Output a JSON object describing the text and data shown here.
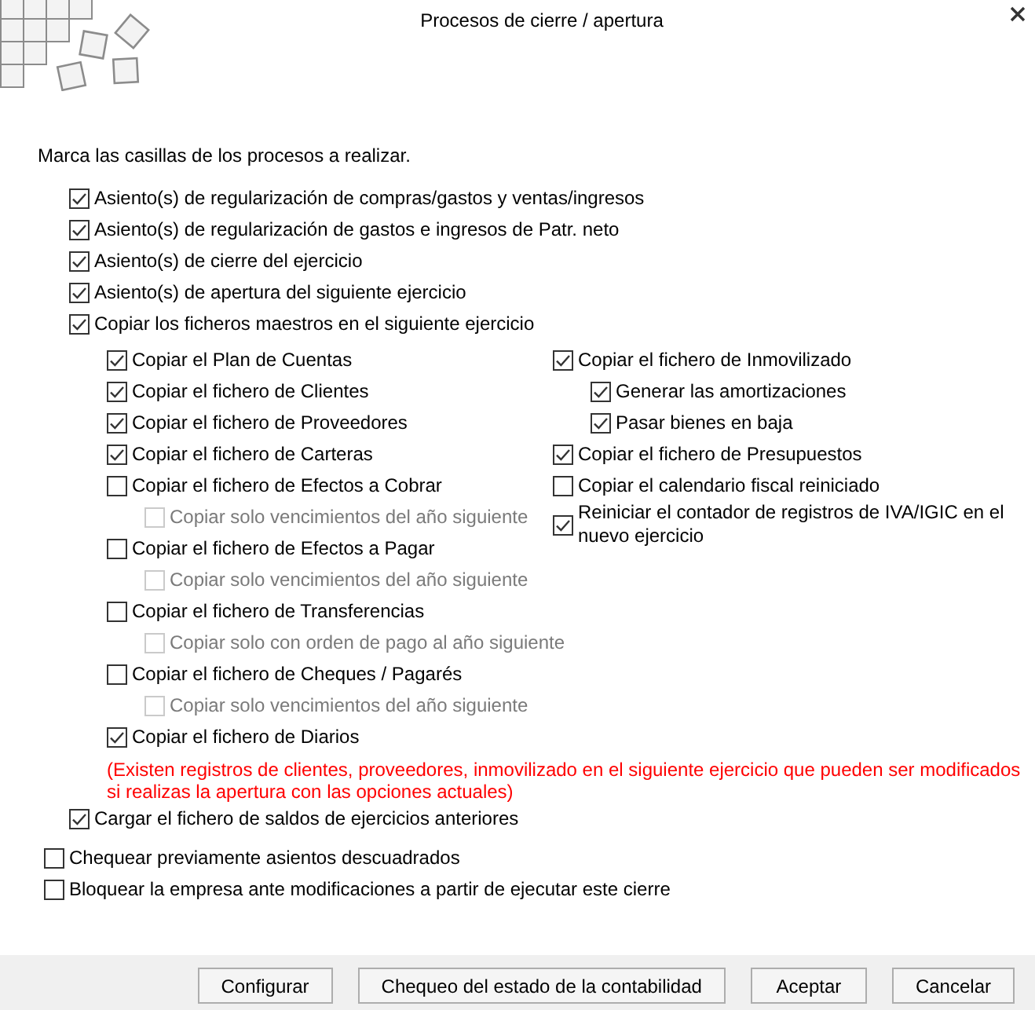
{
  "window": {
    "title": "Procesos de cierre / apertura"
  },
  "instruction": "Marca las casillas de los procesos a realizar.",
  "processes": [
    {
      "label": "Asiento(s) de regularización de compras/gastos y ventas/ingresos",
      "checked": true
    },
    {
      "label": "Asiento(s) de regularización de gastos e ingresos de Patr. neto",
      "checked": true
    },
    {
      "label": "Asiento(s) de cierre del ejercicio",
      "checked": true
    },
    {
      "label": "Asiento(s) de apertura del siguiente ejercicio",
      "checked": true
    },
    {
      "label": "Copiar los ficheros maestros en el siguiente ejercicio",
      "checked": true,
      "columns": [
        {
          "items": [
            {
              "label": "Copiar el Plan de Cuentas",
              "checked": true
            },
            {
              "label": "Copiar el fichero de Clientes",
              "checked": true
            },
            {
              "label": "Copiar el fichero de Proveedores",
              "checked": true
            },
            {
              "label": "Copiar el fichero de Carteras",
              "checked": true
            },
            {
              "label": "Copiar el fichero de Efectos a Cobrar",
              "checked": false,
              "children": [
                {
                  "label": "Copiar solo vencimientos del año siguiente",
                  "checked": false,
                  "disabled": true
                }
              ]
            },
            {
              "label": "Copiar el fichero de Efectos a Pagar",
              "checked": false,
              "children": [
                {
                  "label": "Copiar solo vencimientos del año siguiente",
                  "checked": false,
                  "disabled": true
                }
              ]
            },
            {
              "label": "Copiar el fichero de Transferencias",
              "checked": false,
              "children": [
                {
                  "label": "Copiar solo con orden de pago al año siguiente",
                  "checked": false,
                  "disabled": true
                }
              ]
            },
            {
              "label": "Copiar el fichero de Cheques / Pagarés",
              "checked": false,
              "children": [
                {
                  "label": "Copiar solo vencimientos del año siguiente",
                  "checked": false,
                  "disabled": true
                }
              ]
            },
            {
              "label": "Copiar el fichero de Diarios",
              "checked": true
            }
          ]
        },
        {
          "items": [
            {
              "label": "Copiar el fichero de Inmovilizado",
              "checked": true,
              "children": [
                {
                  "label": "Generar las amortizaciones",
                  "checked": true,
                  "disabled": false
                },
                {
                  "label": "Pasar bienes en baja",
                  "checked": true,
                  "disabled": false
                }
              ]
            },
            {
              "label": "Copiar el fichero de Presupuestos",
              "checked": true
            },
            {
              "label": "Copiar el calendario fiscal reiniciado",
              "checked": false
            },
            {
              "label": "Reiniciar el contador de registros de IVA/IGIC en el nuevo ejercicio",
              "checked": true
            }
          ]
        }
      ],
      "warning": "(Existen registros de clientes, proveedores, inmovilizado en el siguiente ejercicio que pueden ser modificados si realizas la apertura con las opciones actuales)"
    },
    {
      "label": "Cargar el fichero de saldos de ejercicios anteriores",
      "checked": true
    }
  ],
  "options": [
    {
      "label": "Chequear previamente asientos descuadrados",
      "checked": false
    },
    {
      "label": "Bloquear la empresa ante modificaciones a partir de ejecutar este cierre",
      "checked": false
    }
  ],
  "buttons": [
    "Configurar",
    "Chequeo del estado de la contabilidad",
    "Aceptar",
    "Cancelar"
  ]
}
